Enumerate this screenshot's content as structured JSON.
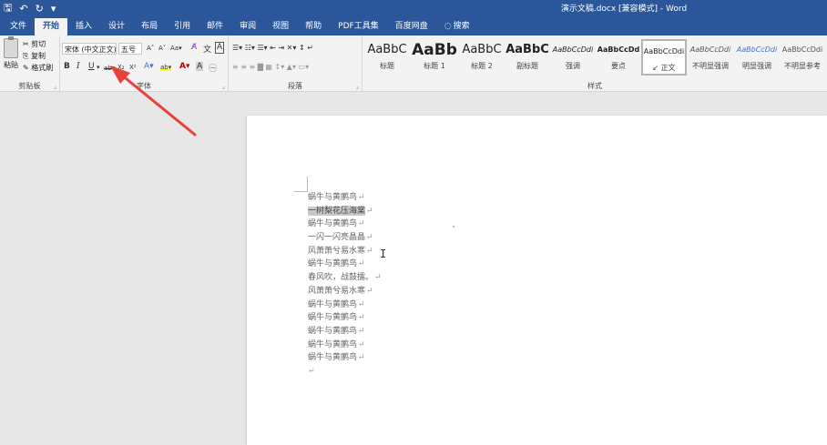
{
  "titlebar": {
    "save_glyph": "🖫",
    "undo_glyph": "↶",
    "redo_glyph": "↻",
    "customize_glyph": "▾",
    "title": "演示文稿.docx [兼容模式] - Word"
  },
  "tabs": [
    "文件",
    "开始",
    "插入",
    "设计",
    "布局",
    "引用",
    "邮件",
    "审阅",
    "视图",
    "帮助",
    "PDF工具集",
    "百度网盘"
  ],
  "search_tab": {
    "icon": "◌",
    "label": "搜索"
  },
  "clipboard": {
    "paste_label": "粘贴",
    "cut": "✂ 剪切",
    "copy": "⎘ 复制",
    "format_painter": "✎ 格式刷",
    "group_label": "剪贴板"
  },
  "font": {
    "font_name": "宋体 (中文正文)",
    "font_size": "五号",
    "grow": "A˄",
    "shrink": "A˅",
    "change_case": "Aa▾",
    "clear_format": "A̸",
    "phonetic": "文",
    "char_border": "A",
    "bold": "B",
    "italic": "I",
    "underline": "U",
    "underline_dd": "▾",
    "strikethrough": "abc",
    "subscript": "X₂",
    "superscript": "X²",
    "text_effect": "A▾",
    "highlight": "ab▾",
    "font_color": "A▾",
    "char_shading": "A",
    "enclose": "㊀",
    "group_label": "字体"
  },
  "paragraph": {
    "row1": "☰▾ ☷▾ ☰▾  ⇤ ⇥  ✕▾  ↕  ↵",
    "row2": "≡ ≡ ≡ ▇ ▦  ↕▾  ▲▾  ▭▾",
    "group_label": "段落"
  },
  "styles": {
    "items": [
      {
        "sample": "AaBbC",
        "name": "标题"
      },
      {
        "sample": "AaBb",
        "name": "标题 1"
      },
      {
        "sample": "AaBbC",
        "name": "标题 2"
      },
      {
        "sample": "AaBbC",
        "name": "副标题"
      },
      {
        "sample": "AaBbCcDdi",
        "name": "强调"
      },
      {
        "sample": "AaBbCcDd",
        "name": "要点"
      },
      {
        "sample": "AaBbCcDdi",
        "name": "正文"
      },
      {
        "sample": "AaBbCcDdi",
        "name": "不明显强调"
      },
      {
        "sample": "AaBbCcDdi",
        "name": "明显强调"
      },
      {
        "sample": "AaBbCcDdi",
        "name": "不明显参考"
      }
    ],
    "selected_check": "↙",
    "group_label": "样式"
  },
  "document": {
    "lines": [
      "蜗牛与黄鹂鸟",
      "一树梨花压海棠",
      "蜗牛与黄鹂鸟",
      "一闪一闪亮晶晶",
      "风萧萧兮易水寒",
      "蜗牛与黄鹂鸟",
      "春风吹，战鼓擂。",
      "风萧萧兮易水寒",
      "蜗牛与黄鹂鸟",
      "蜗牛与黄鹂鸟",
      "蜗牛与黄鹂鸟",
      "蜗牛与黄鹂鸟",
      "蜗牛与黄鹂鸟"
    ],
    "selected_index": 1,
    "para_mark": "↵",
    "cursor_glyph": "I",
    "end_mark": "↵"
  },
  "colors": {
    "title_bg": "#2b579a",
    "ribbon_bg": "#f3f3f3",
    "canvas_bg": "#e7e7e7",
    "arrow": "#e8413a"
  }
}
